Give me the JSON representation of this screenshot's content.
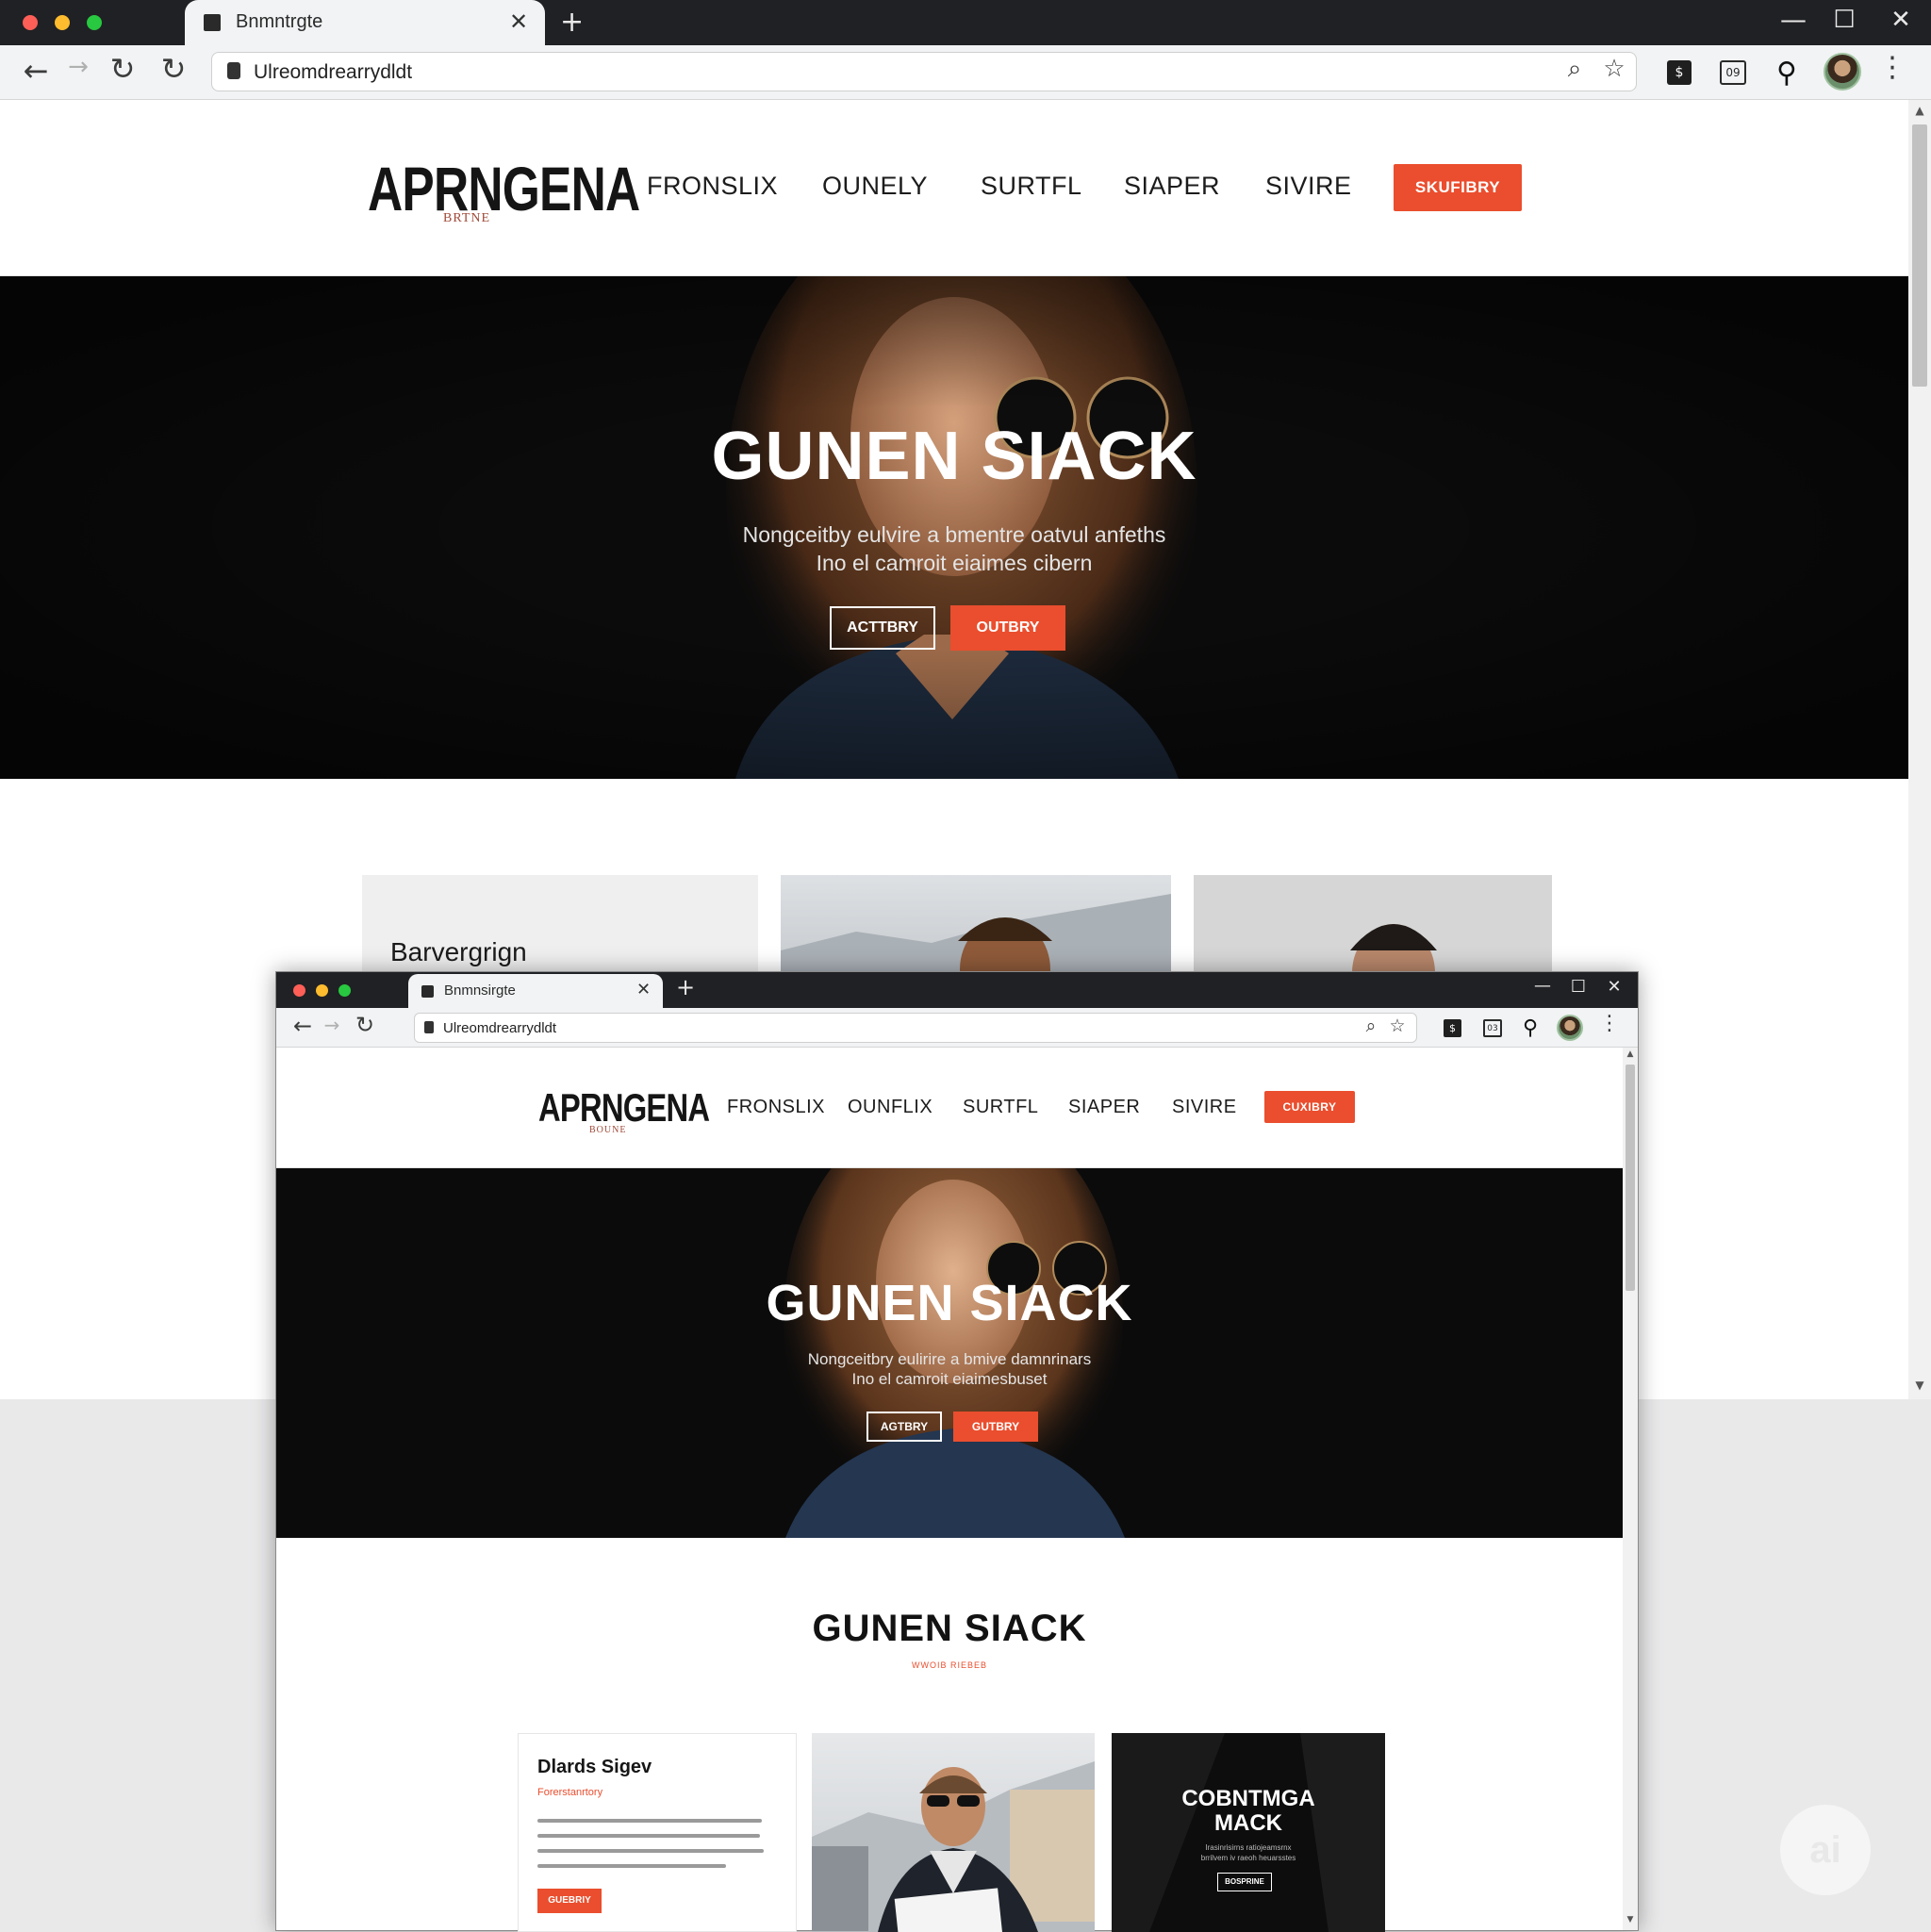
{
  "outer_window": {
    "tab_title": "Bnmntrgte",
    "address": "Ulreomdrearrydldt",
    "site": {
      "logo": "APRNGENA",
      "logo_sub": "BRTNE",
      "nav": [
        "FRONSLIX",
        "OUNELY",
        "SURTFL",
        "SIAPER",
        "SIVIRE"
      ],
      "cta": "SKUFIBRY",
      "hero": {
        "title": "GUNEN SIACK",
        "subtitle_line1": "Nongceitby eulvire a bmentre oatvul anfeths",
        "subtitle_line2": "Ino el camroit eiaimes cibern",
        "btn_outline": "ACTTBRY",
        "btn_solid": "OUTBRY"
      },
      "card1_title": "Barvergrign"
    }
  },
  "inner_window": {
    "tab_title": "Bnmnsirgte",
    "address": "Ulreomdrearrydldt",
    "site": {
      "logo": "APRNGENA",
      "logo_sub": "BOUNE",
      "nav": [
        "FRONSLIX",
        "OUNFLIX",
        "SURTFL",
        "SIAPER",
        "SIVIRE"
      ],
      "cta": "CUXIBRY",
      "hero": {
        "title": "GUNEN SIACK",
        "subtitle_line1": "Nongceitbry eulirire a bmive damnrinars",
        "subtitle_line2": "Ino el camroit eiaimesbuset",
        "btn_outline": "AGTBRY",
        "btn_solid": "GUTBRY"
      },
      "section": {
        "title": "GUNEN SIACK",
        "subtitle": "WWOIB RIEBEB"
      },
      "card1": {
        "title": "Dlards Sigev",
        "subtitle": "Forerstanrtory",
        "button": "GUEBRIY"
      },
      "card3": {
        "title_line1": "COBNTMGA",
        "title_line2": "MACK",
        "text": "Irasinrisirns ratiojeamsrnx\nbrrilvem iv raeoh heuarsstes",
        "button": "BOSPRINE"
      }
    }
  },
  "watermark": "ai",
  "colors": {
    "accent": "#ea4e2e",
    "chrome_dark": "#202124",
    "chrome_light": "#f1f3f4",
    "hero_bg": "#0b0b0b"
  },
  "icons": [
    "back-arrow-icon",
    "forward-arrow-icon",
    "reload-icon",
    "lock-icon",
    "search-icon",
    "star-icon",
    "extension-icon",
    "menu-kebab-icon",
    "minimize-icon",
    "maximize-icon",
    "close-icon",
    "new-tab-icon"
  ]
}
